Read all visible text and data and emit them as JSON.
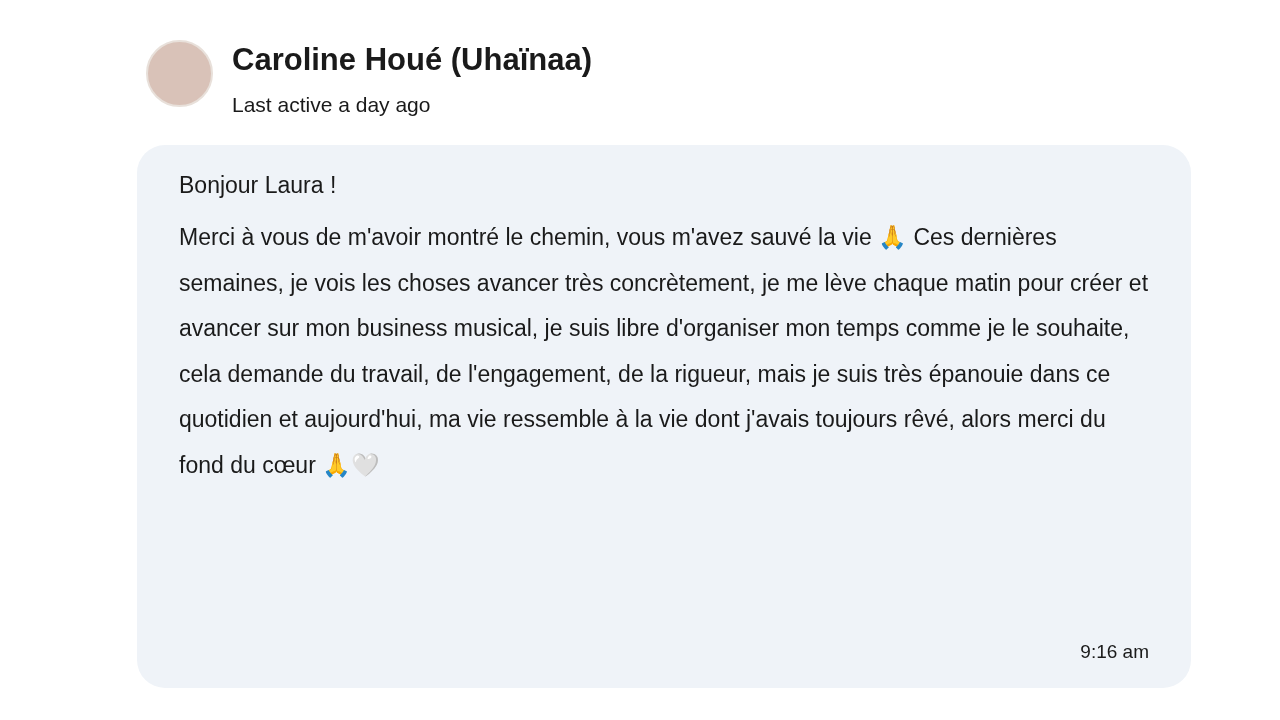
{
  "contact": {
    "name": "Caroline Houé (Uhaïnaa)",
    "status": "Last active a day ago"
  },
  "message": {
    "greeting": "Bonjour Laura !",
    "body": "Merci à vous de m'avoir montré le chemin, vous m'avez sauvé la vie 🙏 Ces dernières semaines, je vois les choses avancer très concrètement, je me lève chaque matin pour créer et avancer sur mon business musical, je suis libre d'organiser mon temps comme je le souhaite, cela demande du travail, de l'engagement, de la rigueur, mais je suis très épanouie dans ce quotidien et aujourd'hui, ma vie ressemble à la vie dont j'avais toujours rêvé, alors merci du fond du cœur 🙏🤍",
    "time": "9:16 am"
  }
}
